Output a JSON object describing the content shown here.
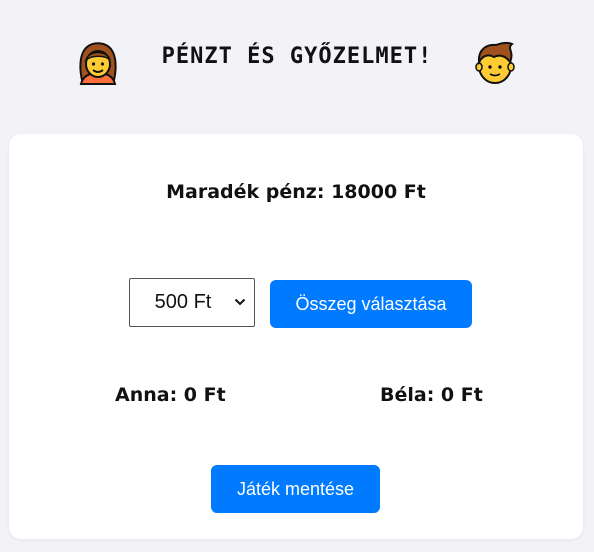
{
  "header": {
    "title": "PÉNZT ÉS GYŐZELMET!",
    "left_icon": "woman-face-icon",
    "right_icon": "man-face-icon"
  },
  "game": {
    "remaining_money": "Maradék pénz: 18000 Ft",
    "amount_select_value": "500 Ft",
    "choose_amount_label": "Összeg választása",
    "save_game_label": "Játék mentése"
  },
  "players": {
    "anna": "Anna: 0 Ft",
    "bela": "Béla: 0 Ft"
  },
  "colors": {
    "accent": "#007bff",
    "background": "#f2f2f7",
    "card": "#ffffff"
  }
}
